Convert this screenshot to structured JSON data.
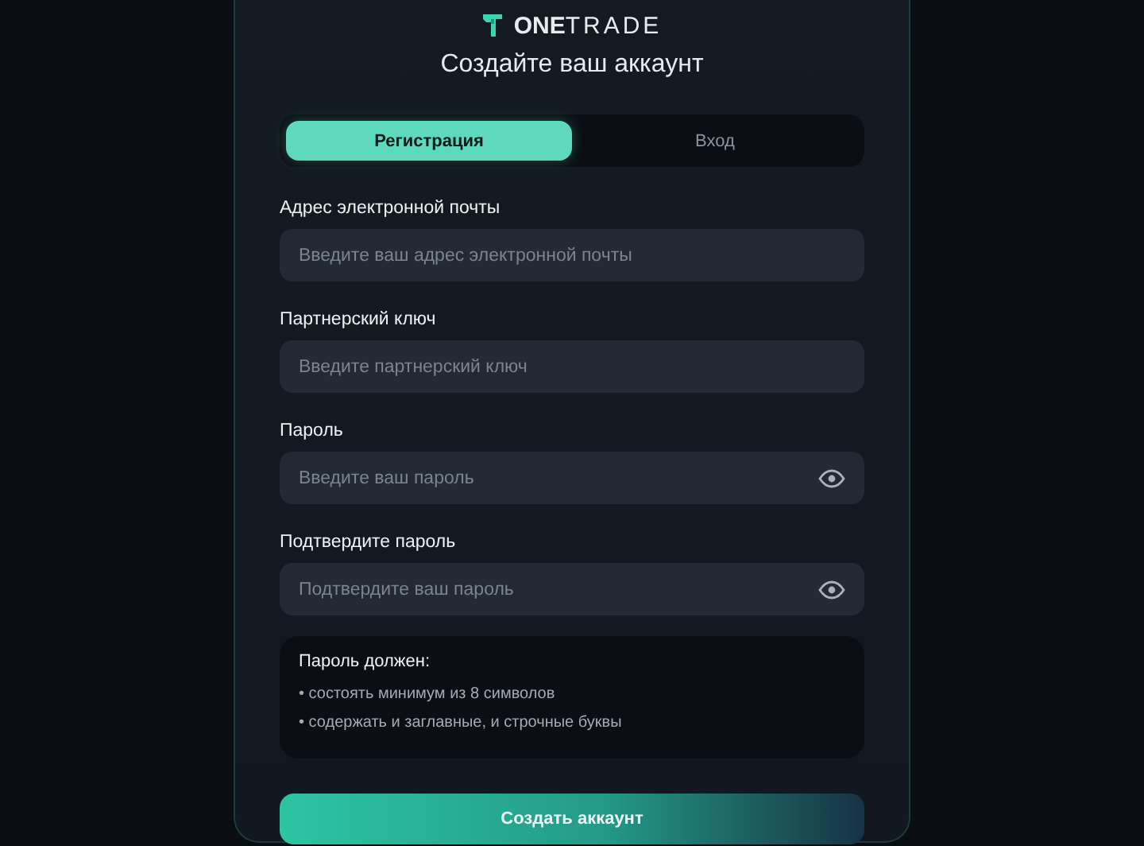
{
  "logo": {
    "bold": "ONE",
    "light": "TRADE"
  },
  "title": "Создайте ваш аккаунт",
  "tabs": [
    {
      "label": "Регистрация",
      "selected": true
    },
    {
      "label": "Вход",
      "selected": false
    }
  ],
  "fields": [
    {
      "label": "Адрес электронной почты",
      "placeholder": "Введите ваш адрес электронной почты",
      "kind": "text"
    },
    {
      "label": "Партнерский ключ",
      "placeholder": "Введите партнерский ключ",
      "kind": "text"
    },
    {
      "label": "Пароль",
      "placeholder": "Введите ваш пароль",
      "kind": "password"
    },
    {
      "label": "Подтвердите пароль",
      "placeholder": "Подтвердите ваш пароль",
      "kind": "password"
    }
  ],
  "rules": {
    "title": "Пароль должен:",
    "items": [
      "• состоять минимум из 8 символов",
      "• содержать и заглавные, и строчные буквы"
    ]
  },
  "submit": "Создать аккаунт"
}
